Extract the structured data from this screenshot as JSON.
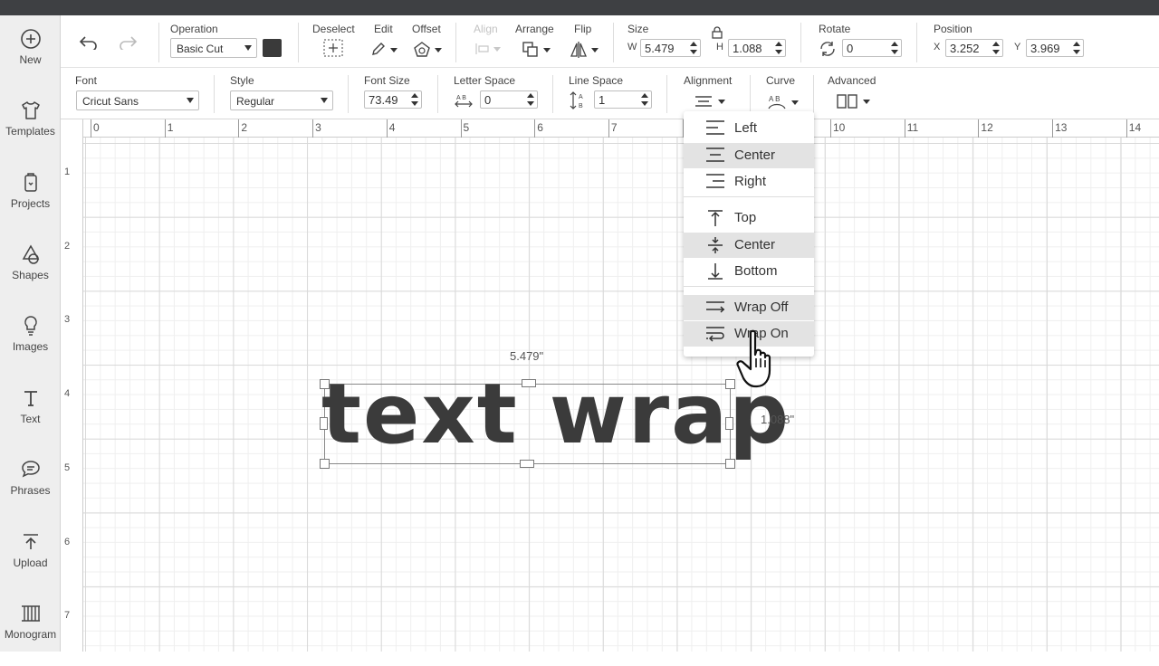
{
  "sidebar": {
    "items": [
      {
        "label": "New",
        "icon": "plus-circle-icon"
      },
      {
        "label": "Templates",
        "icon": "shirt-icon"
      },
      {
        "label": "Projects",
        "icon": "projects-icon"
      },
      {
        "label": "Shapes",
        "icon": "shapes-icon"
      },
      {
        "label": "Images",
        "icon": "lightbulb-icon"
      },
      {
        "label": "Text",
        "icon": "text-icon"
      },
      {
        "label": "Phrases",
        "icon": "speech-bubble-icon"
      },
      {
        "label": "Upload",
        "icon": "upload-icon"
      },
      {
        "label": "Monogram",
        "icon": "monogram-icon"
      }
    ]
  },
  "toolbar1": {
    "operation_label": "Operation",
    "operation_value": "Basic Cut",
    "operation_color": "#3a3a3a",
    "deselect_label": "Deselect",
    "edit_label": "Edit",
    "offset_label": "Offset",
    "align_label": "Align",
    "arrange_label": "Arrange",
    "flip_label": "Flip",
    "size_label": "Size",
    "w_label": "W",
    "w_value": "5.479",
    "h_label": "H",
    "h_value": "1.088",
    "rotate_label": "Rotate",
    "rotate_value": "0",
    "position_label": "Position",
    "x_label": "X",
    "x_value": "3.252",
    "y_label": "Y",
    "y_value": "3.969"
  },
  "toolbar2": {
    "font_label": "Font",
    "font_value": "Cricut Sans",
    "style_label": "Style",
    "style_value": "Regular",
    "font_size_label": "Font Size",
    "font_size_value": "73.49",
    "letter_space_label": "Letter Space",
    "letter_space_value": "0",
    "line_space_label": "Line Space",
    "line_space_value": "1",
    "alignment_label": "Alignment",
    "curve_label": "Curve",
    "advanced_label": "Advanced"
  },
  "rulers": {
    "top": [
      "0",
      "1",
      "2",
      "3",
      "4",
      "5",
      "6",
      "7",
      "8",
      "9",
      "10",
      "11",
      "12",
      "13",
      "14"
    ],
    "left": [
      "1",
      "2",
      "3",
      "4",
      "5",
      "6",
      "7"
    ]
  },
  "canvas": {
    "text": "text wrap",
    "width_dim": "5.479\"",
    "height_dim": "1.088\""
  },
  "alignment_menu": {
    "items": [
      {
        "label": "Left",
        "highlighted": false
      },
      {
        "label": "Center",
        "highlighted": true
      },
      {
        "label": "Right",
        "highlighted": false
      },
      {
        "label": "Top",
        "highlighted": false
      },
      {
        "label": "Center",
        "highlighted": true
      },
      {
        "label": "Bottom",
        "highlighted": false
      },
      {
        "label": "Wrap Off",
        "highlighted": true
      },
      {
        "label": "Wrap On",
        "highlighted": true
      }
    ]
  },
  "colors": {
    "text_fill": "#3b3b3b",
    "highlight": "#e3e3e3",
    "sidebar_bg": "#eeeeee"
  }
}
